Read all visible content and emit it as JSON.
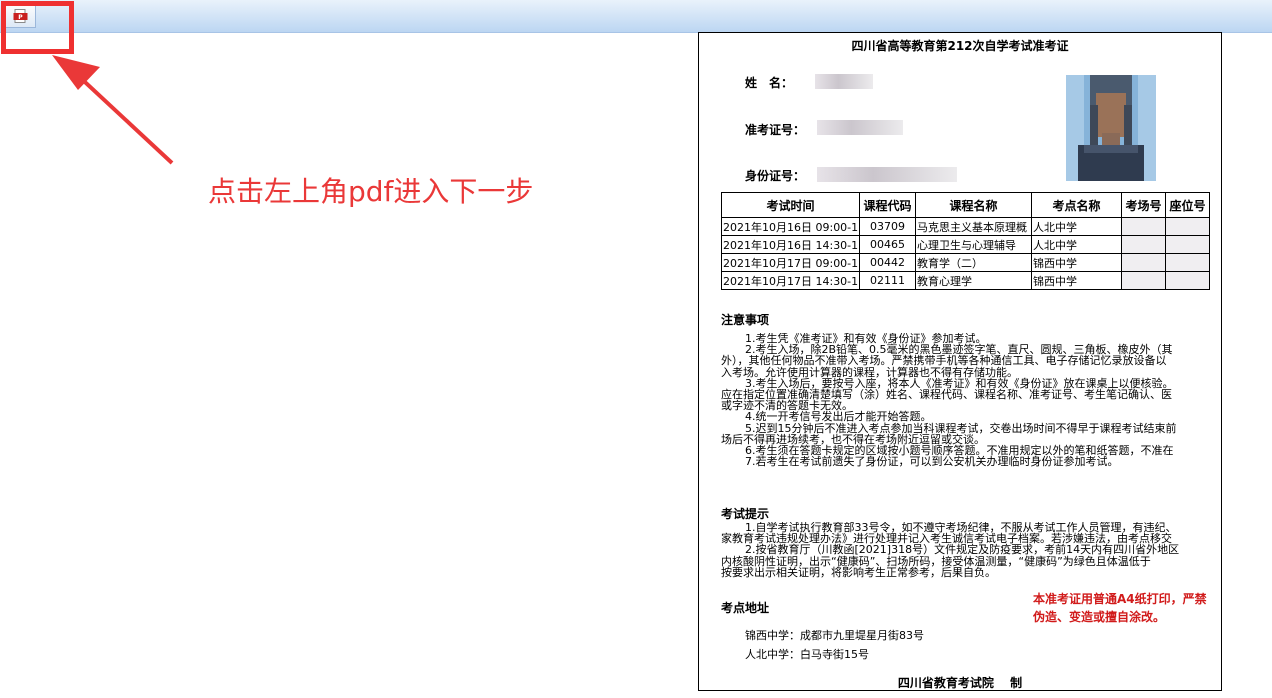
{
  "annotation": {
    "hint": "点击左上角pdf进入下一步"
  },
  "toolbar": {
    "pdf_icon_letter": "P"
  },
  "ticket": {
    "title": "四川省高等教育第212次自学考试准考证",
    "name_label": "姓　名：",
    "admission_label": "准考证号：",
    "id_label": "身份证号：",
    "table": {
      "headers": [
        "考试时间",
        "课程代码",
        "课程名称",
        "考点名称",
        "考场号",
        "座位号"
      ],
      "rows": [
        [
          "2021年10月16日 09:00-11",
          "03709",
          "马克思主义基本原理概",
          "人北中学"
        ],
        [
          "2021年10月16日 14:30-17",
          "00465",
          "心理卫生与心理辅导",
          "人北中学"
        ],
        [
          "2021年10月17日 09:00-11",
          "00442",
          "教育学（二）",
          "锦西中学"
        ],
        [
          "2021年10月17日 14:30-17",
          "02111",
          "教育心理学",
          "锦西中学"
        ]
      ]
    },
    "notice_title": "注意事项",
    "notice_lines": [
      "1.考生凭《准考证》和有效《身份证》参加考试。",
      "2.考生入场，除2B铅笔、0.5毫米的黑色墨迹签字笔、直尺、圆规、三角板、橡皮外（其",
      "外），其他任何物品不准带入考场。严禁携带手机等各种通信工具、电子存储记忆录放设备以",
      "入考场。允许使用计算器的课程，计算器也不得有存储功能。",
      "3.考生入场后，要按号入座，将本人《准考证》和有效《身份证》放在课桌上以便核验。",
      "应在指定位置准确清楚填写（涂）姓名、课程代码、课程名称、准考证号、考生笔记确认、医",
      "或字迹不清的答题卡无效。",
      "4.统一开考信号发出后才能开始答题。",
      "5.迟到15分钟后不准进入考点参加当科课程考试，交卷出场时间不得早于课程考试结束前",
      "场后不得再进场续考，也不得在考场附近逗留或交谈。",
      "6.考生须在答题卡规定的区域按小题号顺序答题。不准用规定以外的笔和纸答题，不准在",
      "7.若考生在考试前遗失了身份证，可以到公安机关办理临时身份证参加考试。"
    ],
    "tips_title": "考试提示",
    "tips_lines": [
      "1.自学考试执行教育部33号令，如不遵守考场纪律，不服从考试工作人员管理，有违纪、",
      "家教育考试违规处理办法》进行处理并记入考生诚信考试电子档案。若涉嫌违法，由考点移交",
      "2.按省教育厅（川教函[2021]318号）文件规定及防疫要求，考前14天内有四川省外地区",
      "内核酸阴性证明，出示“健康码”、扫场所码，接受体温测量，“健康码”为绿色且体温低于",
      "按要求出示相关证明，将影响考生正常参考，后果自负。"
    ],
    "print_note": "本准考证用普通A4纸打印，严禁伪造、变造或擅自涂改。",
    "address_title": "考点地址",
    "addresses": [
      "锦西中学：成都市九里堤星月街83号",
      "人北中学：白马寺街15号"
    ],
    "issuer": "四川省教育考试院　 制"
  },
  "colors": {
    "toolbar_top": "#e9f2fb",
    "toolbar_bottom": "#bcd6f2",
    "annotation_red": "#ea3838",
    "note_red": "#d11b1b"
  }
}
